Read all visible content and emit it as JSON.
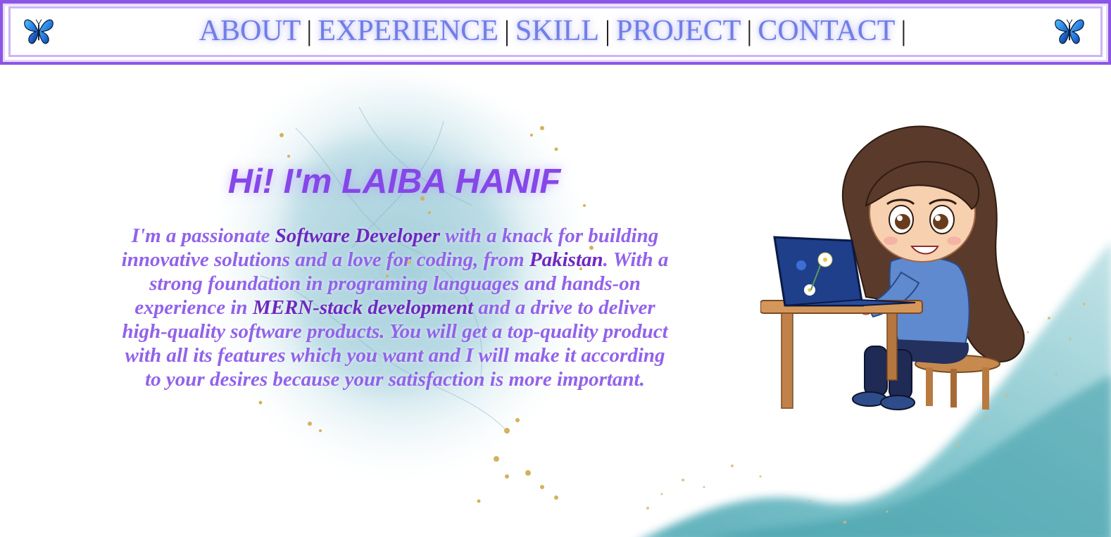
{
  "nav": {
    "links": [
      {
        "label": "ABOUT"
      },
      {
        "label": "EXPERIENCE"
      },
      {
        "label": "SKILL"
      },
      {
        "label": "PROJECT"
      },
      {
        "label": "CONTACT"
      }
    ],
    "separator": "|",
    "icons": [
      "butterfly-icon",
      "butterfly-icon"
    ]
  },
  "hero": {
    "title": "Hi! I'm LAIBA HANIF",
    "intro": {
      "p1": "I'm a passionate ",
      "role": "Software Developer",
      "p2": " with a knack for building innovative solutions and a love for coding, from ",
      "country": "Pakistan",
      "p3": ". With a strong foundation in programing languages and hands-on experience in ",
      "stack": "MERN-stack development",
      "p4": " and a drive to deliver high-quality software products. You will get a top-quality product with all its features which you want and I will make it according to your desires because your satisfaction is more important."
    },
    "illustration": "girl-with-laptop-illustration"
  },
  "colors": {
    "accent": "#8b55e6",
    "nav_link": "#6f7fe6",
    "title": "#8647e8",
    "text": "#9262ea",
    "text_strong": "#6e28c0",
    "splash": "#9ccbd8",
    "gold": "#d4b25a"
  }
}
